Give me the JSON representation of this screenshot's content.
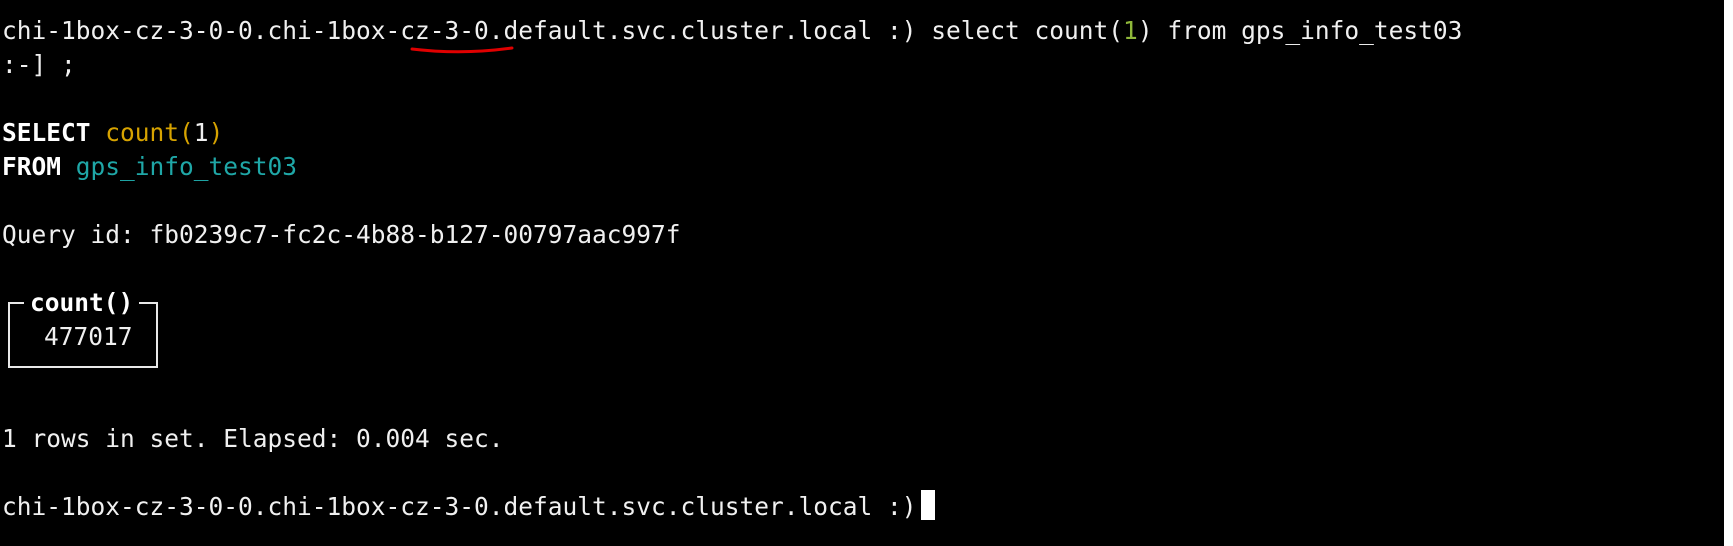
{
  "terminal": {
    "prompt_host": "chi-1box-cz-3-0-0.chi-1box-cz-3-0.default.svc.cluster.local",
    "prompt_suffix": " :) ",
    "command_part1": "select count(",
    "command_num": "1",
    "command_part2": ") from gps_info_test03",
    "continuation": ":-] ;",
    "formatted_select_kw": "SELECT",
    "formatted_select_fn": "count(",
    "formatted_select_num": "1",
    "formatted_select_close": ")",
    "formatted_from_kw": "FROM",
    "formatted_from_table": "gps_info_test03",
    "query_id_line": "Query id: fb0239c7-fc2c-4b88-b127-00797aac997f",
    "result_header": "count()",
    "result_value": "477017",
    "summary": "1 rows in set. Elapsed: 0.004 sec.",
    "final_prompt": "chi-1box-cz-3-0-0.chi-1box-cz-3-0.default.svc.cluster.local :)"
  },
  "colors": {
    "background": "#000000",
    "text": "#f0f0f0",
    "function": "#d7a300",
    "table": "#1fa7a7",
    "number": "#8fb83a",
    "annotation": "#e00000"
  }
}
